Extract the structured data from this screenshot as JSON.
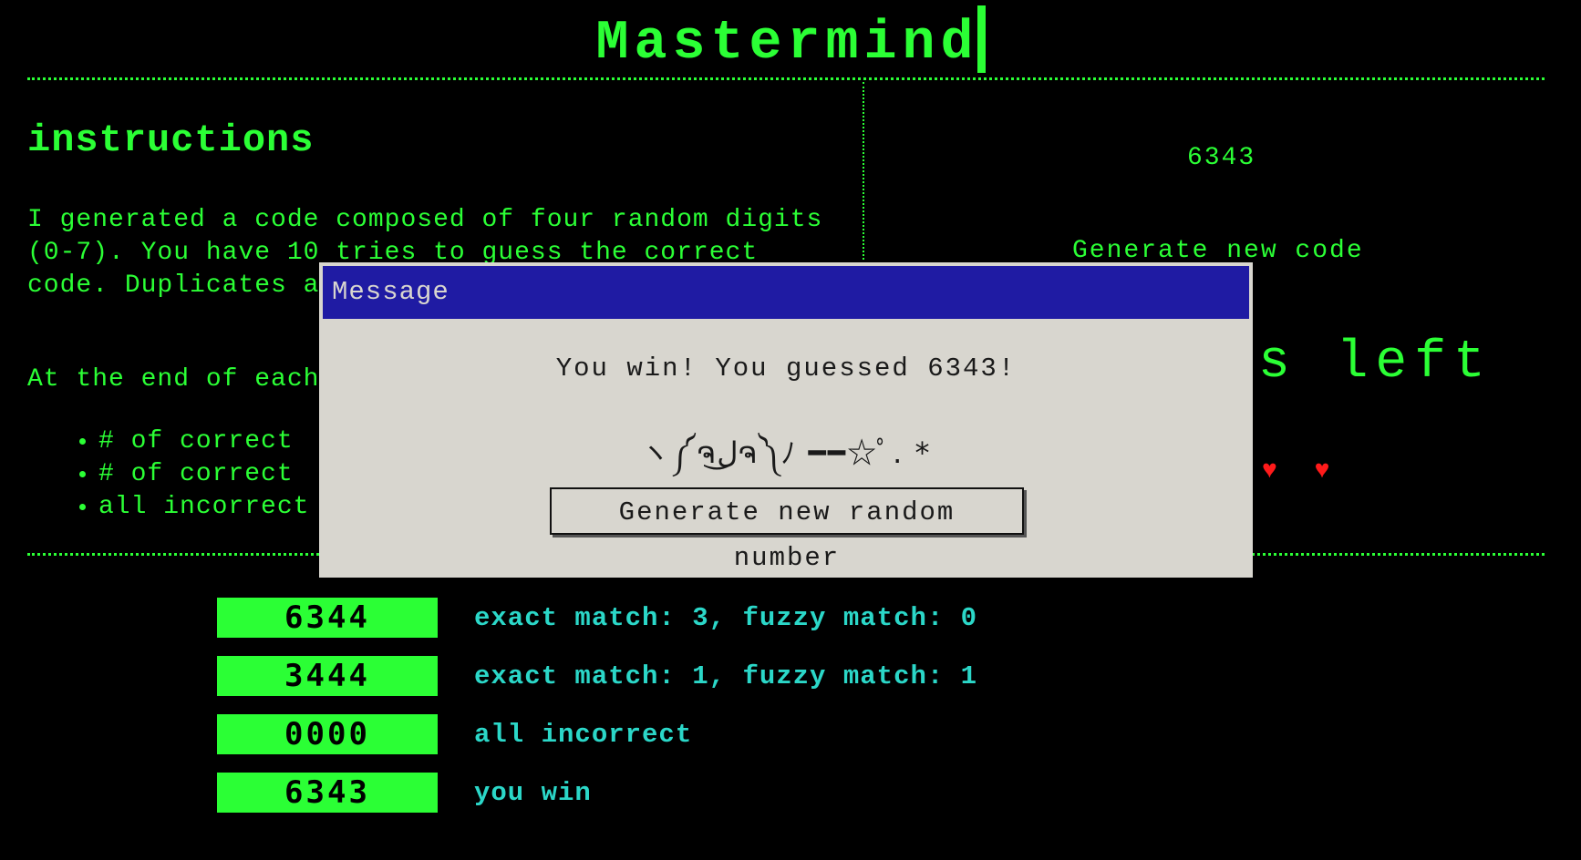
{
  "app": {
    "title": "Mastermind"
  },
  "instructions": {
    "heading": "instructions",
    "paragraph1": "I generated a code composed of four random digits (0-7). You have 10 tries to guess the correct code. Duplicates are possible.",
    "paragraph2": "At the end of each guess, I'll tell you:",
    "bullets": [
      "# of correct",
      "# of correct",
      "all incorrect"
    ]
  },
  "side_panel": {
    "code": "6343",
    "generate_code_label": "Generate new code",
    "tries_left_text": "s left",
    "hearts": "♥ ♥"
  },
  "guesses": [
    {
      "code": "6344",
      "result": "exact match: 3, fuzzy match: 0"
    },
    {
      "code": "3444",
      "result": "exact match: 1, fuzzy match: 1"
    },
    {
      "code": "0000",
      "result": "all incorrect"
    },
    {
      "code": "6343",
      "result": "you win"
    }
  ],
  "modal": {
    "title": "Message",
    "message": "You win! You guessed 6343!",
    "kaomoji": "ヽ༼ຈل͜ຈ༽ﾉ ━━☆ﾟ. *",
    "button_label": "Generate new random number"
  },
  "colors": {
    "background": "#000000",
    "terminal_green": "#2bff35",
    "result_cyan": "#2bd7c8",
    "heart_red": "#ff1a1a",
    "modal_bg": "#d8d6cf",
    "modal_titlebar": "#1f1ba3"
  }
}
